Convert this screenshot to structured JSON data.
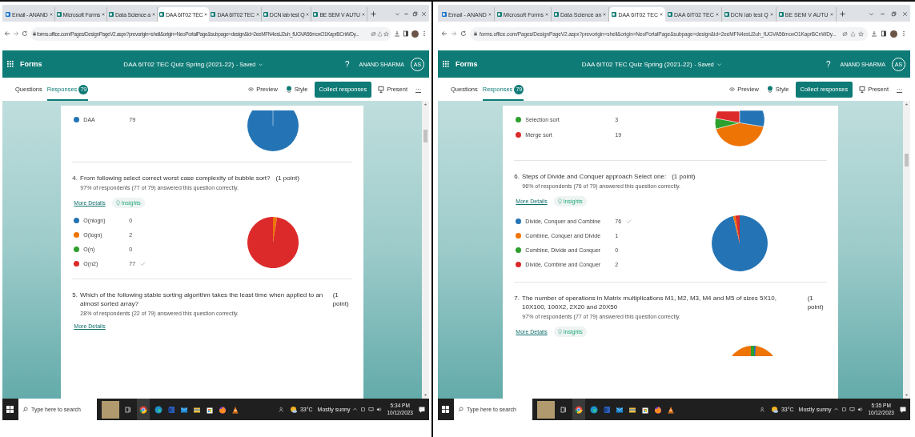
{
  "screens": [
    {
      "browser_tabs": [
        {
          "label": "Email - ANAND",
          "kind": "mail",
          "selected": false
        },
        {
          "label": "Microsoft Forms",
          "kind": "forms",
          "selected": false
        },
        {
          "label": "Data Science a",
          "kind": "forms",
          "selected": false
        },
        {
          "label": "DAA 6IT02 TEC",
          "kind": "forms",
          "selected": true
        },
        {
          "label": "DAA 6IT02 TEC",
          "kind": "forms",
          "selected": false
        },
        {
          "label": "DCN lab test Q",
          "kind": "forms",
          "selected": false
        },
        {
          "label": "BE SEM V AUTU",
          "kind": "forms",
          "selected": false
        }
      ],
      "address": "forms.office.com/Pages/DesignPageV2.aspx?prevorigin=shell&origin=NeoPortalPage&subpage=design&id=2eeMFN4esU2uh_fUGVA56moxO1KaprBCnWDy...",
      "app_name": "Forms",
      "form_title": "DAA 6IT02 TEC Quiz Spring (2021-22)",
      "save_status": "- Saved",
      "help": "?",
      "user_name": "ANAND SHARMA",
      "user_initials": "AS",
      "nav_tabs": [
        {
          "label": "Questions",
          "selected": false
        },
        {
          "label": "Responses",
          "count": "79",
          "selected": true
        }
      ],
      "actions": [
        {
          "label": "Preview",
          "kind": "preview"
        },
        {
          "label": "Style",
          "kind": "style"
        },
        {
          "label": "Collect responses",
          "kind": "primary"
        },
        {
          "label": "Present",
          "kind": "present"
        },
        {
          "label": "···",
          "kind": "more"
        }
      ],
      "questions": [
        {
          "kind": "cut_top",
          "legend": [
            {
              "label": "DAA",
              "count": "79",
              "color": "#2474b5",
              "correct": false
            }
          ]
        },
        {
          "kind": "full",
          "number": "4.",
          "text": "From following select correct worst case complexity of bubble sort?",
          "points": "(1 point)",
          "stat": "97% of respondents (77 of 79) answered this question correctly.",
          "more_details": "More Details",
          "insights": "Insights",
          "legend": [
            {
              "count": "0",
              "color": "#2474b5",
              "correct": false
            },
            {
              "count": "2",
              "color": "#ee7406",
              "correct": false
            },
            {
              "count": "0",
              "color": "#2ca02c",
              "correct": false
            },
            {
              "count": "77",
              "color": "#dc2a2a",
              "correct": true
            }
          ],
          "chart_data": {
            "type": "pie",
            "categories": [
              "O(nlogn)",
              "O(logn)",
              "O(n)",
              "O(n2)"
            ],
            "values": [
              0,
              2.53,
              0,
              97.47
            ]
          }
        },
        {
          "kind": "text_only",
          "number": "5.",
          "text": "Which of the following stable sorting algorithm takes the least time when applied to an almost sorted array?",
          "points": "(1 point)",
          "stat": "28% of respondents (22 of 79) answered this question correctly.",
          "more_details": "More Details"
        }
      ],
      "taskbar": {
        "search_placeholder": "Type here to search",
        "temperature": "33°C",
        "weather": "Mostly sunny",
        "time": "5:34 PM",
        "date": "10/12/2023"
      }
    },
    {
      "browser_tabs": [
        {
          "label": "Email - ANAND",
          "kind": "mail",
          "selected": false
        },
        {
          "label": "Microsoft Forms",
          "kind": "forms",
          "selected": false
        },
        {
          "label": "Data Science an",
          "kind": "forms",
          "selected": false
        },
        {
          "label": "DAA 6IT02 TEC",
          "kind": "forms",
          "selected": true
        },
        {
          "label": "DAA 6IT02 TEC",
          "kind": "forms",
          "selected": false
        },
        {
          "label": "DCN lab test Q",
          "kind": "forms",
          "selected": false
        },
        {
          "label": "BE SEM V AUTU",
          "kind": "forms",
          "selected": false
        }
      ],
      "address": "forms.office.com/Pages/DesignPageV2.aspx?prevorigin=shell&origin=NeoPortalPage&subpage=design&id=2eeMFN4esU2uh_fUGVA56moxO1KaprBCnWDy...",
      "app_name": "Forms",
      "form_title": "DAA 6IT02 TEC Quiz Spring (2021-22)",
      "save_status": "- Saved",
      "help": "?",
      "user_name": "ANAND SHARMA",
      "user_initials": "AS",
      "nav_tabs": [
        {
          "label": "Questions",
          "selected": false
        },
        {
          "label": "Responses",
          "count": "79",
          "selected": true
        }
      ],
      "actions": [
        {
          "label": "Preview",
          "kind": "preview"
        },
        {
          "label": "Style",
          "kind": "style"
        },
        {
          "label": "Collect responses",
          "kind": "primary"
        },
        {
          "label": "Present",
          "kind": "present"
        },
        {
          "label": "···",
          "kind": "more"
        }
      ],
      "questions": [
        {
          "kind": "cut_top",
          "legend": [
            {
              "label": "Selection sort",
              "count": "3",
              "color": "#2ca02c",
              "correct": false
            },
            {
              "label": "Merge sort",
              "count": "19",
              "color": "#dc2a2a",
              "correct": false
            }
          ]
        },
        {
          "kind": "full",
          "number": "6.",
          "text": "Steps of Divide and Conquer approach Select one:",
          "points": "(1 point)",
          "stat": "96% of respondents (76 of 79) answered this question correctly.",
          "more_details": "More Details",
          "insights": "Insights",
          "legend": [
            {
              "count": "76",
              "color": "#2474b5",
              "correct": true
            },
            {
              "count": "1",
              "color": "#ee7406",
              "correct": false
            },
            {
              "count": "0",
              "color": "#2ca02c",
              "correct": false
            },
            {
              "count": "2",
              "color": "#dc2a2a",
              "correct": false
            }
          ],
          "chart_data": {
            "type": "pie",
            "categories": [
              "Divide, Conquer and Combine",
              "Combine, Conquer and Divide",
              "Combine, Divide and Conquer",
              "Divide, Combine and Conquer"
            ],
            "values": [
              96.2,
              1.27,
              0,
              2.53
            ]
          }
        },
        {
          "kind": "cut_bottom",
          "number": "7.",
          "text": "The number of operations in Matrix multiplications M1, M2, M3, M4 and M5 of sizes 5X10, 10X100, 100X2, 2X20 and 20X50",
          "points": "(1 point)",
          "stat": "97% of respondents (77 of 79) answered this question correctly.",
          "more_details": "More Details",
          "insights": "Insights"
        }
      ],
      "taskbar": {
        "search_placeholder": "Type here to search",
        "temperature": "33°C",
        "weather": "Mostly sunny",
        "time": "5:35 PM",
        "date": "10/12/2023"
      }
    }
  ]
}
